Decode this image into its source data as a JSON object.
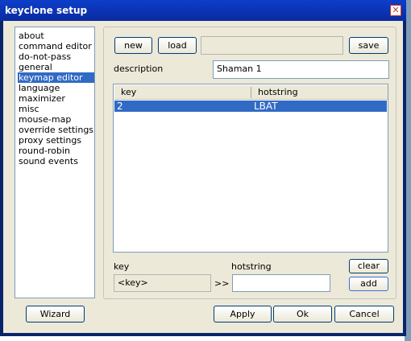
{
  "window": {
    "title": "keyclone setup",
    "close_glyph": "✕"
  },
  "sidebar": {
    "items": [
      {
        "label": "about"
      },
      {
        "label": "command editor"
      },
      {
        "label": "do-not-pass"
      },
      {
        "label": "general"
      },
      {
        "label": "keymap editor",
        "selected": true
      },
      {
        "label": "language"
      },
      {
        "label": "maximizer"
      },
      {
        "label": "misc"
      },
      {
        "label": "mouse-map"
      },
      {
        "label": "override settings"
      },
      {
        "label": "proxy settings"
      },
      {
        "label": "round-robin"
      },
      {
        "label": "sound events"
      }
    ]
  },
  "keymap": {
    "new_label": "new",
    "load_label": "load",
    "file_value": "",
    "save_label": "save",
    "description_label": "description",
    "description_value": "Shaman 1",
    "table": {
      "columns": [
        "key",
        "hotstring"
      ],
      "rows": [
        {
          "key": "2",
          "hotstring": "LBAT"
        }
      ]
    },
    "key_label": "key",
    "hotstring_label": "hotstring",
    "key_value": "<key>",
    "arrow": ">>",
    "hotstring_value": "",
    "clear_label": "clear",
    "add_label": "add"
  },
  "footer": {
    "wizard_label": "Wizard",
    "apply_label": "Apply",
    "ok_label": "Ok",
    "cancel_label": "Cancel"
  },
  "colors": {
    "titlebar": "#0a2aa0",
    "selection": "#316ac5",
    "dialog_bg": "#ece9d8"
  }
}
